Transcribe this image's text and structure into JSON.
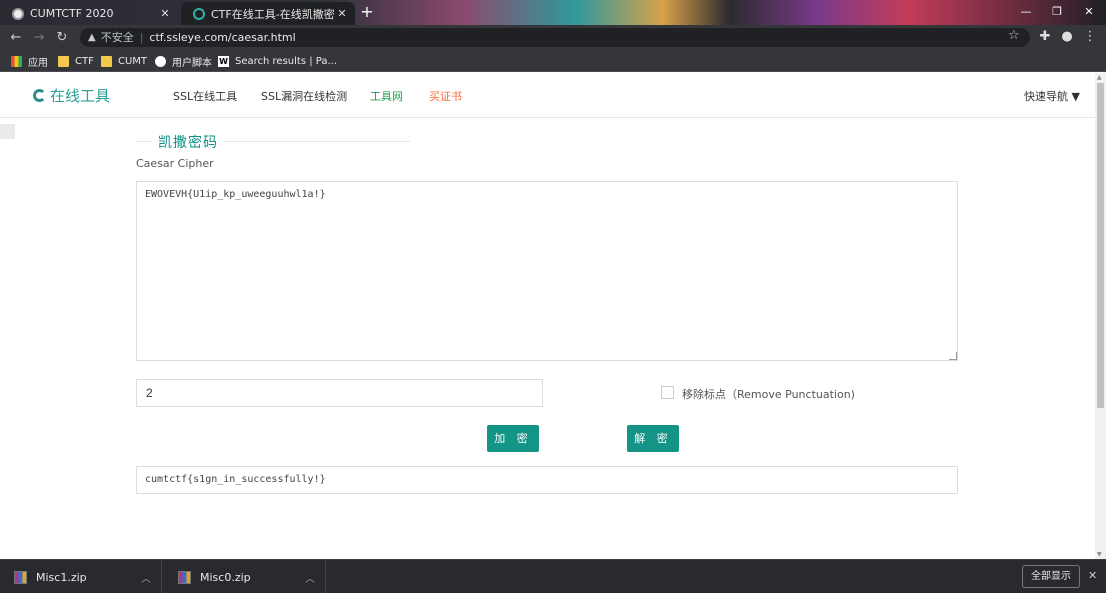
{
  "browser": {
    "tabs": [
      {
        "title": "CUMTCTF 2020",
        "active": false
      },
      {
        "title": "CTF在线工具-在线凯撒密码加密",
        "active": true
      }
    ],
    "new_tab": "+",
    "address": {
      "security_label": "不安全",
      "url": "ctf.ssleye.com/caesar.html"
    },
    "bookmarks": [
      {
        "label": "应用",
        "icon": "apps-icon"
      },
      {
        "label": "CTF",
        "icon": "folder-icon"
      },
      {
        "label": "CUMT",
        "icon": "folder-icon"
      },
      {
        "label": "用户脚本",
        "icon": "userscript-icon"
      },
      {
        "label": "Search results | Pa...",
        "icon": "wikipedia-icon"
      }
    ]
  },
  "site": {
    "logo_text": "在线工具",
    "nav": [
      {
        "label": "SSL在线工具",
        "color": "#333333"
      },
      {
        "label": "SSL漏洞在线检测",
        "color": "#333333"
      },
      {
        "label": "工具网",
        "color": "#1e9e4f"
      },
      {
        "label": "买证书",
        "color": "#ff6a33"
      }
    ],
    "quick_nav": "快速导航"
  },
  "tool": {
    "title": "凯撒密码",
    "subtitle": "Caesar Cipher",
    "input_text": "EWOVEVH{U1ip_kp_uweeguuhwl1a!}",
    "shift_value": "2",
    "remove_punctuation": {
      "label": "移除标点（Remove Punctuation)",
      "checked": false
    },
    "encrypt_label": "加 密",
    "decrypt_label": "解 密",
    "result_text": "cumtctf{s1gn_in_successfully!}"
  },
  "downloads": {
    "items": [
      {
        "name": "Misc1.zip"
      },
      {
        "name": "Misc0.zip"
      }
    ],
    "show_all_label": "全部显示"
  }
}
